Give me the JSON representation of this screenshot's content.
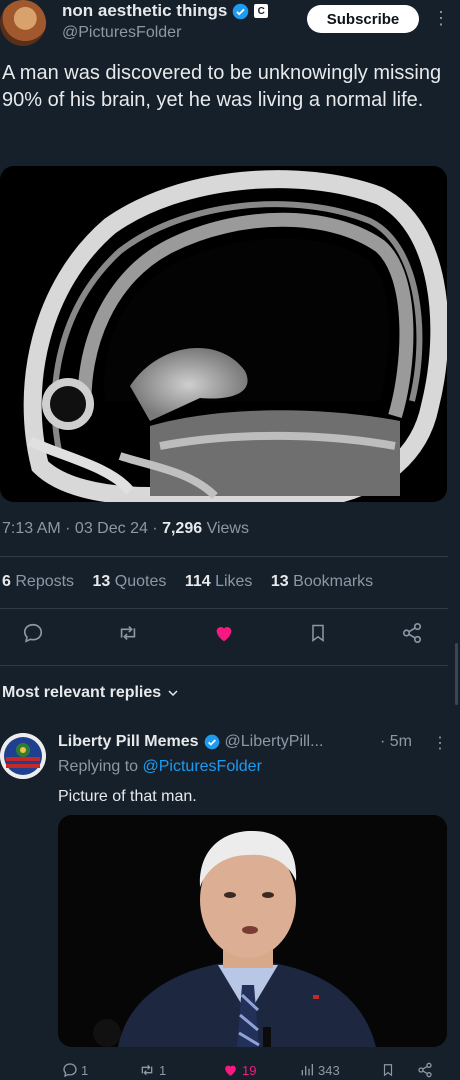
{
  "post": {
    "author_name": "non aesthetic things",
    "badge_letter": "C",
    "author_handle": "@PicturesFolder",
    "subscribe_label": "Subscribe",
    "text": "A man was discovered to be unknowingly missing 90% of his brain, yet he was living a normal life.",
    "time": "7:13 AM",
    "date": "03 Dec 24",
    "views_count": "7,296",
    "views_label": "Views",
    "reposts_count": "6",
    "reposts_label": "Reposts",
    "quotes_count": "13",
    "quotes_label": "Quotes",
    "likes_count": "114",
    "likes_label": "Likes",
    "bookmarks_count": "13",
    "bookmarks_label": "Bookmarks"
  },
  "replies": {
    "header": "Most relevant replies"
  },
  "reply": {
    "author_name": "Liberty Pill Memes",
    "author_handle": "@LibertyPill...",
    "time": "5m",
    "replying_prefix": "Replying to",
    "replying_handle": "@PicturesFolder",
    "text": "Picture of that man.",
    "comments": "1",
    "reposts": "1",
    "likes": "19",
    "views": "343"
  },
  "colors": {
    "background": "#15202b",
    "accent": "#1d9bf0",
    "like": "#f91880",
    "muted": "#8b98a5"
  },
  "icons": [
    "verified-icon",
    "kebab-icon",
    "reply-icon",
    "repost-icon",
    "heart-icon",
    "bookmark-icon",
    "share-icon",
    "chevron-down-icon",
    "views-icon"
  ]
}
